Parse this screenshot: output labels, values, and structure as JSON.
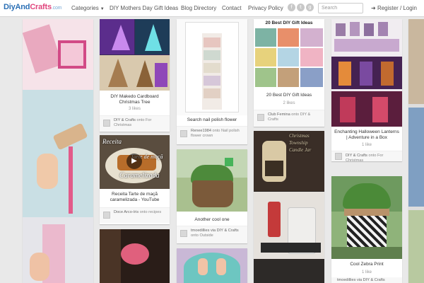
{
  "site": {
    "logo_main": "DiyAnd",
    "logo_accent": "Crafts",
    "logo_tld": ".com"
  },
  "nav": {
    "categories": "Categories",
    "mothers_day": "DIY Mothers Day Gift Ideas",
    "blog_directory": "Blog Directory",
    "contact": "Contact",
    "privacy": "Privacy Policy",
    "search_placeholder": "Search",
    "auth": "Register / Login"
  },
  "icons": {
    "social": [
      "facebook-icon",
      "twitter-icon",
      "gplus-icon"
    ],
    "social_glyphs": [
      "f",
      "t",
      "g"
    ],
    "login_glyph": "➜"
  },
  "pins": {
    "p2": {
      "title": "DIY Makedo Cardboard Christmas Tree",
      "likes": "3 likes",
      "user": "DIY & Crafts",
      "board": "For Christmas"
    },
    "p3": {
      "title": "Search nail polish flower",
      "user": "Renee1984",
      "board": "Nail polish flower crown"
    },
    "p4": {
      "title": "20 Best DIY Gift Ideas",
      "likes": "2 likes",
      "user": "Club Femina",
      "board": "DIY & Crafts",
      "img_title": "20 Best DIY Gift Ideas"
    },
    "p5": {
      "title": "Enchanting Halloween Lanterns | Adventure in a Box",
      "likes": "1 like",
      "user": "DIY & Crafts",
      "board": "For Christmas"
    },
    "p6": {
      "title": "Receita Tarte de maçã caramelizada - YouTube",
      "user": "Doce Arco-íris",
      "board": "recipes",
      "img_text_1": "Receita",
      "img_text_2": "Tarte de maçã",
      "img_text_3": "Caramelizada"
    },
    "p7": {
      "title": "Another cool one",
      "user": "tmoedillies via DIY & Crafts",
      "board": "Outside"
    },
    "p8": {
      "img_text": "Christmas Township Candle Jar"
    },
    "p9": {
      "title": "Cool Zebra Print",
      "likes": "1 like",
      "user": "tmoedillies via DIY & Crafts",
      "board": ""
    }
  },
  "attrib_word": "onto",
  "colors": {
    "accent_blue": "#2a6fb5",
    "accent_pink": "#e0467d",
    "bg": "#e9e9e9"
  }
}
